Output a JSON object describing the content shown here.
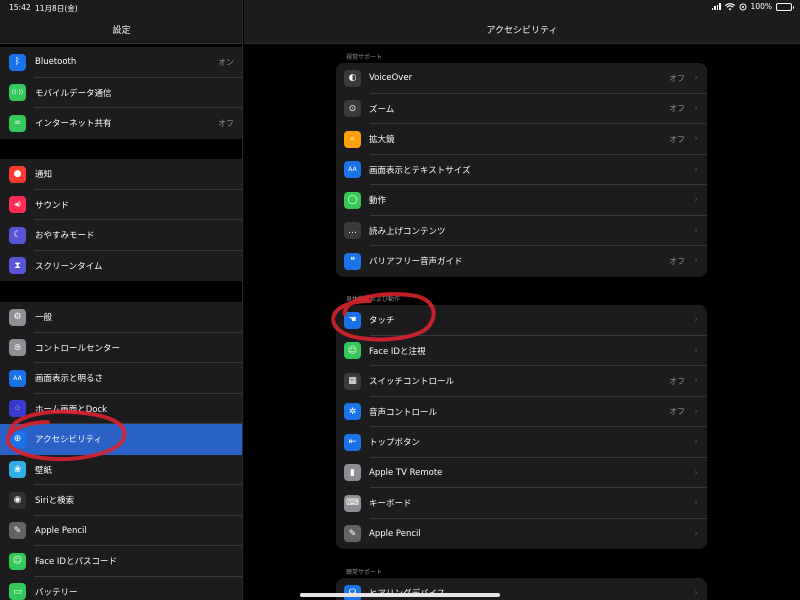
{
  "status_bar": {
    "time": "15:42",
    "date": "11月8日(金)",
    "battery": "100%"
  },
  "sidebar": {
    "title": "設定",
    "groups": [
      [
        {
          "label": "Bluetooth",
          "value": "オン",
          "icon": "bluetooth-icon",
          "color": "#1a73e8"
        },
        {
          "label": "モバイルデータ通信",
          "value": "",
          "icon": "cellular-antenna-icon",
          "color": "#34c759"
        },
        {
          "label": "インターネット共有",
          "value": "オフ",
          "icon": "link-chain-icon",
          "color": "#34c759"
        }
      ],
      [
        {
          "label": "通知",
          "value": "",
          "icon": "notification-icon",
          "color": "#ff3b30"
        },
        {
          "label": "サウンド",
          "value": "",
          "icon": "speaker-icon",
          "color": "#ff2d55"
        },
        {
          "label": "おやすみモード",
          "value": "",
          "icon": "moon-icon",
          "color": "#5856d6"
        },
        {
          "label": "スクリーンタイム",
          "value": "",
          "icon": "hourglass-icon",
          "color": "#5856d6"
        }
      ],
      [
        {
          "label": "一般",
          "value": "",
          "icon": "gear-icon",
          "color": "#8e8e93"
        },
        {
          "label": "コントロールセンター",
          "value": "",
          "icon": "toggle-switches-icon",
          "color": "#8e8e93"
        },
        {
          "label": "画面表示と明るさ",
          "value": "",
          "icon": "text-size-icon",
          "color": "#1a73e8"
        },
        {
          "label": "ホーム画面とDock",
          "value": "",
          "icon": "home-grid-icon",
          "color": "#3a3ad0"
        },
        {
          "label": "アクセシビリティ",
          "value": "",
          "icon": "accessibility-icon",
          "color": "#1a73e8",
          "selected": true
        },
        {
          "label": "壁紙",
          "value": "",
          "icon": "wallpaper-flower-icon",
          "color": "#32ade6"
        },
        {
          "label": "Siriと検索",
          "value": "",
          "icon": "siri-icon",
          "color": "#303030"
        },
        {
          "label": "Apple Pencil",
          "value": "",
          "icon": "pencil-icon",
          "color": "#636366"
        },
        {
          "label": "Face IDとパスコード",
          "value": "",
          "icon": "face-id-icon",
          "color": "#34c759"
        },
        {
          "label": "バッテリー",
          "value": "",
          "icon": "battery-icon",
          "color": "#34c759"
        }
      ]
    ]
  },
  "detail": {
    "title": "アクセシビリティ",
    "sections": [
      {
        "header": "視覚サポート",
        "rows": [
          {
            "label": "VoiceOver",
            "value": "オフ",
            "icon": "voiceover-icon",
            "color": "#3a3a3c"
          },
          {
            "label": "ズーム",
            "value": "オフ",
            "icon": "zoom-icon",
            "color": "#3a3a3c"
          },
          {
            "label": "拡大鏡",
            "value": "オフ",
            "icon": "magnifier-icon",
            "color": "#ff9f0a"
          },
          {
            "label": "画面表示とテキストサイズ",
            "value": "",
            "icon": "text-size-icon",
            "color": "#1a73e8"
          },
          {
            "label": "動作",
            "value": "",
            "icon": "motion-icon",
            "color": "#34c759"
          },
          {
            "label": "読み上げコンテンツ",
            "value": "",
            "icon": "speech-bubble-icon",
            "color": "#3a3a3c"
          },
          {
            "label": "バリアフリー音声ガイド",
            "value": "オフ",
            "icon": "audio-description-icon",
            "color": "#1a73e8"
          }
        ]
      },
      {
        "header": "身体機能および動作",
        "rows": [
          {
            "label": "タッチ",
            "value": "",
            "icon": "touch-hand-icon",
            "color": "#1a73e8"
          },
          {
            "label": "Face IDと注視",
            "value": "",
            "icon": "face-id-icon",
            "color": "#34c759"
          },
          {
            "label": "スイッチコントロール",
            "value": "オフ",
            "icon": "switch-grid-icon",
            "color": "#3a3a3c"
          },
          {
            "label": "音声コントロール",
            "value": "オフ",
            "icon": "voice-control-icon",
            "color": "#1a73e8"
          },
          {
            "label": "トップボタン",
            "value": "",
            "icon": "top-button-icon",
            "color": "#1a73e8"
          },
          {
            "label": "Apple TV Remote",
            "value": "",
            "icon": "remote-icon",
            "color": "#8e8e93"
          },
          {
            "label": "キーボード",
            "value": "",
            "icon": "keyboard-icon",
            "color": "#8e8e93"
          },
          {
            "label": "Apple Pencil",
            "value": "",
            "icon": "pencil-icon",
            "color": "#636366"
          }
        ]
      },
      {
        "header": "聴覚サポート",
        "rows": [
          {
            "label": "ヒアリングデバイス",
            "value": "",
            "icon": "ear-icon",
            "color": "#1a73e8"
          }
        ]
      }
    ]
  }
}
